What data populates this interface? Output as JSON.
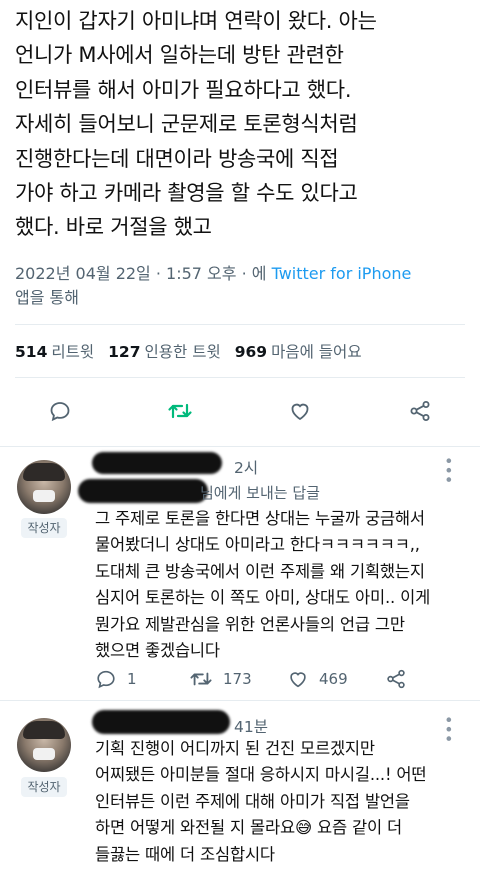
{
  "tweet": {
    "text_lines": [
      "지인이 갑자기 아미냐며 연락이 왔다. 아는",
      "언니가 M사에서 일하는데 방탄 관련한",
      "인터뷰를 해서 아미가 필요하다고 했다.",
      "자세히 들어보니 군문제로 토론형식처럼",
      "진행한다는데 대면이라 방송국에 직접",
      "가야 하고 카메라 촬영을 할 수도 있다고",
      "했다. 바로 거절을 했고"
    ],
    "timestamp": "2022년 04월 22일 · 1:57 오후 · 에",
    "source": "Twitter for iPhone",
    "source_suffix": "앱을 통해"
  },
  "stats": {
    "retweets_count": "514",
    "retweets_label": "리트윗",
    "quotes_count": "127",
    "quotes_label": "인용한 트윗",
    "likes_count": "969",
    "likes_label": "마음에 들어요"
  },
  "actions": {
    "reply_icon": "reply-icon",
    "retweet_icon": "retweet-icon",
    "like_icon": "heart-icon",
    "share_icon": "share-icon"
  },
  "replies": [
    {
      "time": "2시",
      "to_suffix": "님에게 보내는 답글",
      "badge": "작성자",
      "body_lines": [
        "그 주제로 토론을 한다면 상대는 누굴까 궁금해서",
        "물어봤더니 상대도 아미라고 한다ㅋㅋㅋㅋㅋㅋ,,",
        "도대체 큰 방송국에서 이런 주제를 왜 기획했는지",
        "심지어 토론하는 이 쪽도 아미, 상대도 아미.. 이게",
        "뭔가요 제발관심을 위한 언론사들의 언급 그만",
        "했으면 좋겠습니다"
      ],
      "reply_count": "1",
      "retweet_count": "173",
      "like_count": "469"
    },
    {
      "time": "41분",
      "badge": "작성자",
      "body_lines": [
        "기획 진행이 어디까지 된 건진 모르겠지만",
        "어찌됐든 아미분들 절대 응하시지 마시길...! 어떤",
        "인터뷰든 이런 주제에 대해 아미가 직접 발언을",
        "하면 어떻게 와전될 지 몰라요😅 요즘 같이 더",
        "들끓는 때에 더 조심합시다"
      ]
    }
  ],
  "colors": {
    "accent": "#1d9bf0",
    "retweet_active": "#00ba7c",
    "muted": "#536471"
  }
}
